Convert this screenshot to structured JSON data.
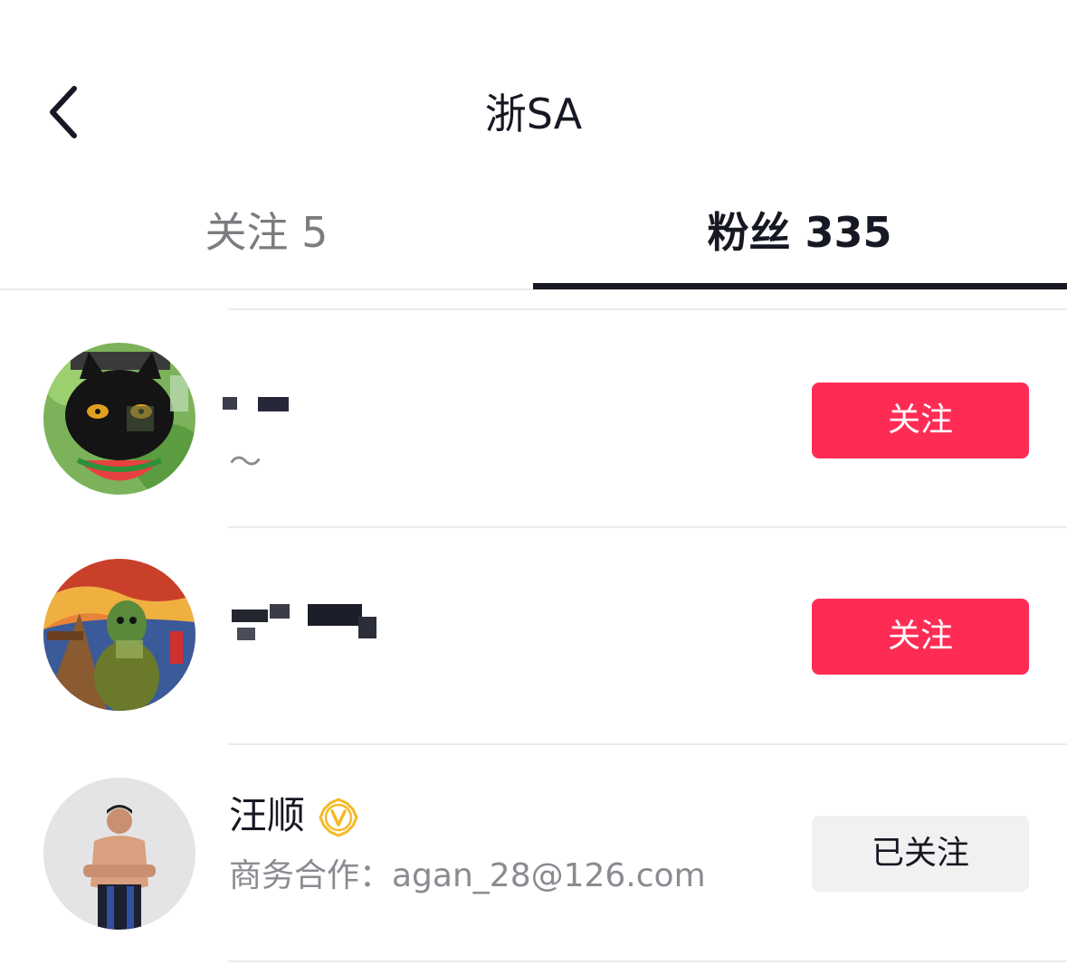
{
  "header": {
    "title": "浙SA",
    "back_icon": "chevron-left-icon"
  },
  "tabs": [
    {
      "label": "关注 5"
    },
    {
      "label": "粉丝 335"
    }
  ],
  "list": [
    {
      "name": "",
      "bio": "～",
      "button": "关注",
      "button_state": "follow",
      "avatar": "black-cat-watermelon-avatar"
    },
    {
      "name": "",
      "bio": "",
      "button": "关注",
      "button_state": "follow",
      "avatar": "scream-painting-avatar"
    },
    {
      "name": "汪顺",
      "verified": true,
      "bio": "商务合作：agan_28@126.com",
      "button": "已关注",
      "button_state": "followed",
      "avatar": "swimmer-photo-avatar"
    }
  ],
  "colors": {
    "accent": "#fe2c55",
    "text": "#161823",
    "muted": "#8a8b91",
    "verified": "#f5b924"
  }
}
